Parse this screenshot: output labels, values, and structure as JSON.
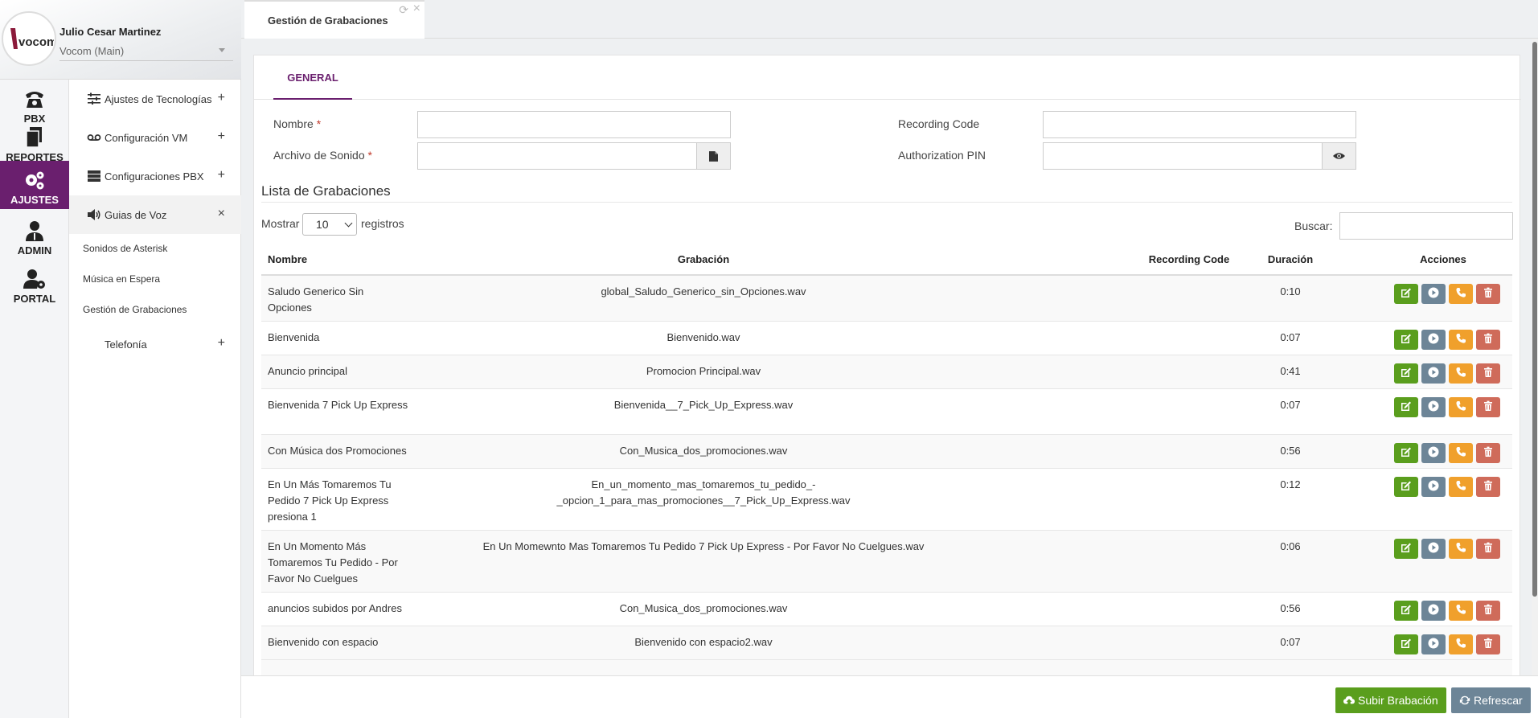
{
  "user": {
    "name": "Julio Cesar Martinez",
    "account": "Vocom (Main)",
    "logo_text": "vocom"
  },
  "rail": [
    {
      "label": "PBX",
      "icon": "phone-icon"
    },
    {
      "label": "REPORTES",
      "icon": "documents-icon"
    },
    {
      "label": "AJUSTES",
      "icon": "cogs-icon",
      "active": true
    },
    {
      "label": "ADMIN",
      "icon": "admin-user-icon"
    },
    {
      "label": "PORTAL",
      "icon": "user-gear-icon"
    }
  ],
  "submenu": {
    "items": [
      {
        "label": "Ajustes de Tecnologías",
        "toggle": "+"
      },
      {
        "label": "Configuración VM",
        "toggle": "+"
      },
      {
        "label": "Configuraciones PBX",
        "toggle": "+"
      },
      {
        "label": "Guias de Voz",
        "toggle": "×"
      }
    ],
    "leaves": [
      "Sonidos de Asterisk",
      "Música en Espera",
      "Gestión de Grabaciones"
    ],
    "telefonia": {
      "label": "Telefonía",
      "toggle": "+"
    }
  },
  "tab": {
    "title": "Gestión de Grabaciones",
    "refresh_glyph": "⟳",
    "close_glyph": "×"
  },
  "panel": {
    "tab_label": "GENERAL"
  },
  "form": {
    "nombre_label": "Nombre",
    "archivo_label": "Archivo de Sonido",
    "required_mark": "*",
    "recording_code_label": "Recording Code",
    "auth_pin_label": "Authorization PIN"
  },
  "list": {
    "title": "Lista de Grabaciones",
    "show_label": "Mostrar",
    "page_size": "10",
    "records_label": "registros",
    "search_label": "Buscar:"
  },
  "table": {
    "headers": {
      "nombre": "Nombre",
      "grabacion": "Grabación",
      "recording_code": "Recording Code",
      "duracion": "Duración",
      "acciones": "Acciones"
    },
    "rows": [
      {
        "nombre": "Saludo Generico Sin Opciones",
        "grabacion": "global_Saludo_Generico_sin_Opciones.wav",
        "code": "",
        "duracion": "0:10"
      },
      {
        "nombre": "Bienvenida",
        "grabacion": "Bienvenido.wav",
        "code": "",
        "duracion": "0:07"
      },
      {
        "nombre": "Anuncio principal",
        "grabacion": "Promocion Principal.wav",
        "code": "",
        "duracion": "0:41"
      },
      {
        "nombre": "Bienvenida 7 Pick Up Express",
        "grabacion": "Bienvenida__7_Pick_Up_Express.wav",
        "code": "",
        "duracion": "0:07"
      },
      {
        "nombre": "Con Música dos Promociones",
        "grabacion": "Con_Musica_dos_promociones.wav",
        "code": "",
        "duracion": "0:56"
      },
      {
        "nombre": "En Un Más Tomaremos Tu Pedido 7 Pick Up Express presiona 1",
        "grabacion": "En_un_momento_mas_tomaremos_tu_pedido_-_opcion_1_para_mas_promociones__7_Pick_Up_Express.wav",
        "code": "",
        "duracion": "0:12"
      },
      {
        "nombre": "En Un Momento Más Tomaremos Tu Pedido - Por Favor No Cuelgues",
        "grabacion": "En Un Momewnto Mas Tomaremos Tu Pedido 7 Pick Up Express - Por Favor No Cuelgues.wav",
        "code": "",
        "duracion": "0:06"
      },
      {
        "nombre": "anuncios subidos por Andres",
        "grabacion": "Con_Musica_dos_promociones.wav",
        "code": "",
        "duracion": "0:56"
      },
      {
        "nombre": "Bienvenido con espacio",
        "grabacion": "Bienvenido con espacio2.wav",
        "code": "",
        "duracion": "0:07"
      }
    ]
  },
  "footer": {
    "upload_label": "Subir Brabación",
    "refresh_label": "Refrescar"
  },
  "colors": {
    "accent": "#6a1f6e",
    "green": "#5a9e1d",
    "gray": "#6d8597",
    "orange": "#f0a02c",
    "red": "#cf6b5a"
  }
}
